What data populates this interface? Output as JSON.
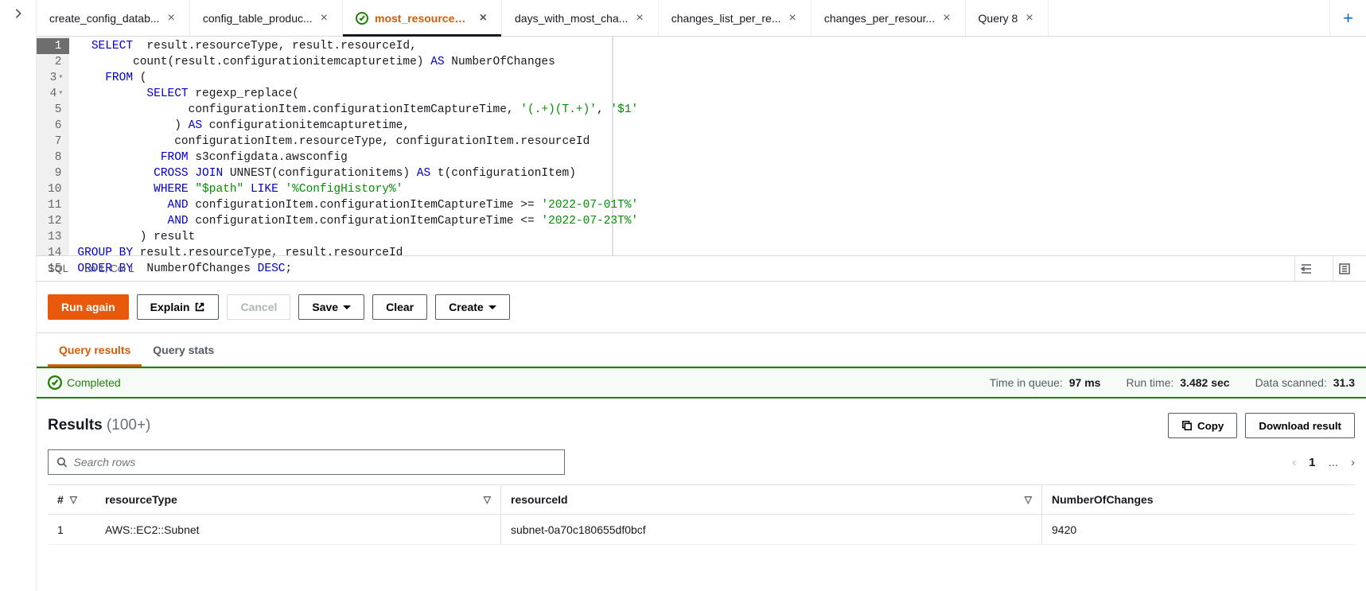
{
  "tabs": [
    {
      "label": "create_config_datab...",
      "hasIcon": false,
      "active": false
    },
    {
      "label": "config_table_produc...",
      "hasIcon": false,
      "active": false
    },
    {
      "label": "most_resources_cau...",
      "hasIcon": true,
      "active": true
    },
    {
      "label": "days_with_most_cha...",
      "hasIcon": false,
      "active": false
    },
    {
      "label": "changes_list_per_re...",
      "hasIcon": false,
      "active": false
    },
    {
      "label": "changes_per_resour...",
      "hasIcon": false,
      "active": false
    },
    {
      "label": "Query 8",
      "hasIcon": false,
      "active": false
    }
  ],
  "editor": {
    "lines": [
      {
        "n": "1",
        "fold": "",
        "sel": true,
        "tokens": [
          {
            "t": "  ",
            "c": ""
          },
          {
            "t": "SELECT",
            "c": "kw"
          },
          {
            "t": "  result.resourceType, result.resourceId,",
            "c": ""
          }
        ]
      },
      {
        "n": "2",
        "fold": "",
        "tokens": [
          {
            "t": "        count(result.configurationitemcapturetime) ",
            "c": ""
          },
          {
            "t": "AS",
            "c": "kw"
          },
          {
            "t": " NumberOfChanges",
            "c": ""
          }
        ]
      },
      {
        "n": "3",
        "fold": "▾",
        "tokens": [
          {
            "t": "    ",
            "c": ""
          },
          {
            "t": "FROM",
            "c": "kw"
          },
          {
            "t": " (",
            "c": ""
          }
        ]
      },
      {
        "n": "4",
        "fold": "▾",
        "tokens": [
          {
            "t": "          ",
            "c": ""
          },
          {
            "t": "SELECT",
            "c": "kw"
          },
          {
            "t": " regexp_replace(",
            "c": ""
          }
        ]
      },
      {
        "n": "5",
        "fold": "",
        "tokens": [
          {
            "t": "                configurationItem.configurationItemCaptureTime, ",
            "c": ""
          },
          {
            "t": "'(.+)(T.+)'",
            "c": "str"
          },
          {
            "t": ", ",
            "c": ""
          },
          {
            "t": "'$1'",
            "c": "str"
          }
        ]
      },
      {
        "n": "6",
        "fold": "",
        "tokens": [
          {
            "t": "              ) ",
            "c": ""
          },
          {
            "t": "AS",
            "c": "kw"
          },
          {
            "t": " configurationitemcapturetime,",
            "c": ""
          }
        ]
      },
      {
        "n": "7",
        "fold": "",
        "tokens": [
          {
            "t": "              configurationItem.resourceType, configurationItem.resourceId",
            "c": ""
          }
        ]
      },
      {
        "n": "8",
        "fold": "",
        "tokens": [
          {
            "t": "            ",
            "c": ""
          },
          {
            "t": "FROM",
            "c": "kw"
          },
          {
            "t": " s3configdata.awsconfig",
            "c": ""
          }
        ]
      },
      {
        "n": "9",
        "fold": "",
        "tokens": [
          {
            "t": "           ",
            "c": ""
          },
          {
            "t": "CROSS JOIN",
            "c": "kw"
          },
          {
            "t": " UNNEST(configurationitems) ",
            "c": ""
          },
          {
            "t": "AS",
            "c": "kw"
          },
          {
            "t": " t(configurationItem)",
            "c": ""
          }
        ]
      },
      {
        "n": "10",
        "fold": "",
        "tokens": [
          {
            "t": "           ",
            "c": ""
          },
          {
            "t": "WHERE",
            "c": "kw"
          },
          {
            "t": " ",
            "c": ""
          },
          {
            "t": "\"$path\"",
            "c": "str"
          },
          {
            "t": " ",
            "c": ""
          },
          {
            "t": "LIKE",
            "c": "kw"
          },
          {
            "t": " ",
            "c": ""
          },
          {
            "t": "'%ConfigHistory%'",
            "c": "str"
          }
        ]
      },
      {
        "n": "11",
        "fold": "",
        "tokens": [
          {
            "t": "             ",
            "c": ""
          },
          {
            "t": "AND",
            "c": "kw"
          },
          {
            "t": " configurationItem.configurationItemCaptureTime >= ",
            "c": ""
          },
          {
            "t": "'2022-07-01T%'",
            "c": "str"
          }
        ]
      },
      {
        "n": "12",
        "fold": "",
        "tokens": [
          {
            "t": "             ",
            "c": ""
          },
          {
            "t": "AND",
            "c": "kw"
          },
          {
            "t": " configurationItem.configurationItemCaptureTime <= ",
            "c": ""
          },
          {
            "t": "'2022-07-23T%'",
            "c": "str"
          }
        ]
      },
      {
        "n": "13",
        "fold": "",
        "tokens": [
          {
            "t": "         ) result",
            "c": ""
          }
        ]
      },
      {
        "n": "14",
        "fold": "",
        "tokens": [
          {
            "t": "",
            "c": ""
          },
          {
            "t": "GROUP BY",
            "c": "kw"
          },
          {
            "t": " result.resourceType, result.resourceId",
            "c": ""
          }
        ]
      },
      {
        "n": "15",
        "fold": "",
        "tokens": [
          {
            "t": "",
            "c": ""
          },
          {
            "t": "ORDER BY",
            "c": "kw"
          },
          {
            "t": "  NumberOfChanges ",
            "c": ""
          },
          {
            "t": "DESC",
            "c": "kw"
          },
          {
            "t": ";",
            "c": ""
          }
        ]
      }
    ]
  },
  "statusBar": {
    "lang": "SQL",
    "pos": "Ln 1, Col 1"
  },
  "actions": {
    "run": "Run again",
    "explain": "Explain",
    "cancel": "Cancel",
    "save": "Save",
    "clear": "Clear",
    "create": "Create"
  },
  "resultTabs": {
    "results": "Query results",
    "stats": "Query stats"
  },
  "banner": {
    "status": "Completed",
    "queueLabel": "Time in queue:",
    "queueVal": "97 ms",
    "runLabel": "Run time:",
    "runVal": "3.482 sec",
    "scanLabel": "Data scanned:",
    "scanVal": "31.3"
  },
  "results": {
    "title": "Results",
    "count": "(100+)",
    "copy": "Copy",
    "download": "Download result",
    "searchPlaceholder": "Search rows",
    "page": "1",
    "dots": "...",
    "columns": {
      "idx": "#",
      "rt": "resourceType",
      "ri": "resourceId",
      "nc": "NumberOfChanges"
    },
    "rows": [
      {
        "idx": "1",
        "rt": "AWS::EC2::Subnet",
        "ri": "subnet-0a70c180655df0bcf",
        "nc": "9420"
      }
    ]
  }
}
